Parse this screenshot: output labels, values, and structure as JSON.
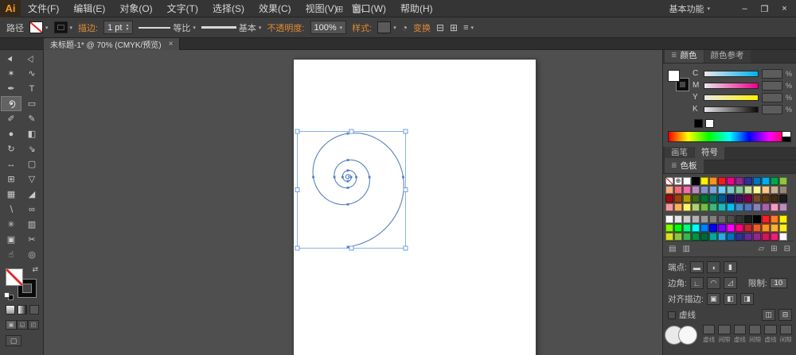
{
  "colors": {
    "accent_orange": "#e08a34",
    "selection_blue": "#7aa7e0",
    "artboard": "#ffffff"
  },
  "titlebar": {
    "logo": "Ai",
    "menus": [
      {
        "id": "file",
        "label": "文件(F)"
      },
      {
        "id": "edit",
        "label": "编辑(E)"
      },
      {
        "id": "object",
        "label": "对象(O)"
      },
      {
        "id": "type",
        "label": "文字(T)"
      },
      {
        "id": "select",
        "label": "选择(S)"
      },
      {
        "id": "effect",
        "label": "效果(C)"
      },
      {
        "id": "view",
        "label": "视图(V)"
      },
      {
        "id": "window",
        "label": "窗口(W)"
      },
      {
        "id": "help",
        "label": "帮助(H)"
      }
    ],
    "workspace": "基本功能",
    "minimize": "–",
    "restore": "❐",
    "close": "×"
  },
  "control_bar": {
    "selection_label": "路径",
    "stroke_link": "描边:",
    "stroke_weight": "1 pt",
    "profile_label": "等比",
    "brush_label": "基本",
    "opacity_link": "不透明度:",
    "opacity_value": "100%",
    "style_label": "样式:",
    "transform_link": "变换"
  },
  "document_tab": {
    "title": "未标题-1* @ 70% (CMYK/预览)",
    "close": "×"
  },
  "toolbar": {
    "tools": [
      {
        "name": "selection-tool",
        "glyph": "►",
        "rot": true
      },
      {
        "name": "direct-selection-tool",
        "glyph": "▷",
        "rot": true
      },
      {
        "name": "magic-wand-tool",
        "glyph": "✶"
      },
      {
        "name": "lasso-tool",
        "glyph": "∿"
      },
      {
        "name": "pen-tool",
        "glyph": "✒"
      },
      {
        "name": "type-tool",
        "glyph": "T"
      },
      {
        "name": "spiral-tool",
        "icon": "spiral",
        "active": true
      },
      {
        "name": "rectangle-tool",
        "glyph": "▭"
      },
      {
        "name": "paintbrush-tool",
        "glyph": "✐"
      },
      {
        "name": "pencil-tool",
        "glyph": "✎"
      },
      {
        "name": "blob-brush-tool",
        "glyph": "●"
      },
      {
        "name": "eraser-tool",
        "glyph": "◧"
      },
      {
        "name": "rotate-tool",
        "glyph": "↻"
      },
      {
        "name": "scale-tool",
        "glyph": "⇘"
      },
      {
        "name": "width-tool",
        "glyph": "↔"
      },
      {
        "name": "free-transform-tool",
        "glyph": "▢"
      },
      {
        "name": "shape-builder-tool",
        "glyph": "⊞"
      },
      {
        "name": "perspective-grid-tool",
        "glyph": "▽"
      },
      {
        "name": "mesh-tool",
        "glyph": "▦"
      },
      {
        "name": "gradient-tool",
        "glyph": "◢"
      },
      {
        "name": "eyedropper-tool",
        "glyph": "∖"
      },
      {
        "name": "blend-tool",
        "glyph": "∞"
      },
      {
        "name": "symbol-sprayer-tool",
        "glyph": "✳"
      },
      {
        "name": "column-graph-tool",
        "glyph": "▥"
      },
      {
        "name": "artboard-tool",
        "glyph": "▣"
      },
      {
        "name": "slice-tool",
        "glyph": "✂"
      },
      {
        "name": "hand-tool",
        "glyph": "☝"
      },
      {
        "name": "zoom-tool",
        "glyph": "◎"
      }
    ]
  },
  "color_panel": {
    "tab_color": "颜色",
    "tab_guide": "颜色参考",
    "channels": [
      "C",
      "M",
      "Y",
      "K"
    ],
    "percent": "%"
  },
  "brush_symbol_panel": {
    "tab_brushes": "画笔",
    "tab_symbols": "符号"
  },
  "swatches_panel": {
    "tab": "色板",
    "group1": [
      [
        "none",
        "reg",
        "#ffffff",
        "#000000",
        "#fff200",
        "#f7941d",
        "#ed1c24",
        "#ec008c",
        "#92278f",
        "#2e3192",
        "#0072bc",
        "#00aeef",
        "#00a651",
        "#8dc63f"
      ],
      [
        "#f9ad81",
        "#f26d7d",
        "#f06eaa",
        "#bd8cbf",
        "#8393ca",
        "#7da7d9",
        "#6dcff6",
        "#7accc8",
        "#82ca9c",
        "#c4df9b",
        "#fff799",
        "#fdc689",
        "#c7b299",
        "#998675"
      ],
      [
        "#9e0b0f",
        "#a0410d",
        "#aba000",
        "#406618",
        "#007236",
        "#00746b",
        "#00588c",
        "#1b1464",
        "#440e62",
        "#7b0046",
        "#754c24",
        "#603913",
        "#3f2a16",
        "#1a1a1a"
      ],
      [
        "#f5989d",
        "#fbaf5d",
        "#fff568",
        "#acd373",
        "#72bf44",
        "#3cb878",
        "#1cbbb4",
        "#00bff3",
        "#448ccb",
        "#5674b9",
        "#8781bd",
        "#a864a8",
        "#f49ac1",
        "#bd8cbf"
      ]
    ],
    "group2": [
      [
        "#ffffff",
        "#e6e6e6",
        "#cccccc",
        "#b3b3b3",
        "#999999",
        "#808080",
        "#666666",
        "#4d4d4d",
        "#333333",
        "#1a1a1a",
        "#000000",
        "#ff1d25",
        "#ff7f27",
        "#fff200"
      ],
      [
        "#7fff00",
        "#00ff00",
        "#00ff7f",
        "#00ffff",
        "#007fff",
        "#0000ff",
        "#7f00ff",
        "#ff00ff",
        "#ff007f",
        "#c1272d",
        "#f15a24",
        "#f7931e",
        "#fbb03b",
        "#fcee21"
      ],
      [
        "#d9e021",
        "#8cc63f",
        "#39b54a",
        "#009245",
        "#006837",
        "#00a99d",
        "#29abe2",
        "#0071bc",
        "#2e3192",
        "#662d91",
        "#93278f",
        "#d4145a",
        "#ed1e79",
        "#ffffff"
      ]
    ]
  },
  "stroke_panel": {
    "cap_label": "端点:",
    "corner_label": "边角:",
    "limit_label": "限制:",
    "limit_value": "10",
    "align_label": "对齐描边:",
    "dashed_label": "虚线",
    "dash_labels": [
      "虚线",
      "间隙",
      "虚线",
      "间隙",
      "虚线",
      "间隙"
    ]
  },
  "icons": {
    "dropdown": "▾",
    "up": "▲",
    "down": "▼",
    "swap": "⇄",
    "menu": "≡",
    "arrange": "⊞",
    "layout": "▥",
    "recolor": "◔",
    "align1": "⊟",
    "align2": "⊞",
    "panel": "≣",
    "screen": "▢",
    "lib": "▤",
    "kind": "▥",
    "folder": "▱",
    "new_swatch": "⊞",
    "trash": "⊟",
    "cap_butt": "▬",
    "cap_round": "◖",
    "cap_square": "▮",
    "join_miter": "∟",
    "join_round": "◠",
    "join_bevel": "◿",
    "align_center": "▣",
    "align_inside": "◧",
    "align_outside": "◨",
    "dash_btn1": "◫",
    "dash_btn2": "⊟",
    "registration": "⊕",
    "draw_normal": "▣",
    "draw_behind": "◱",
    "draw_inside": "◰"
  }
}
